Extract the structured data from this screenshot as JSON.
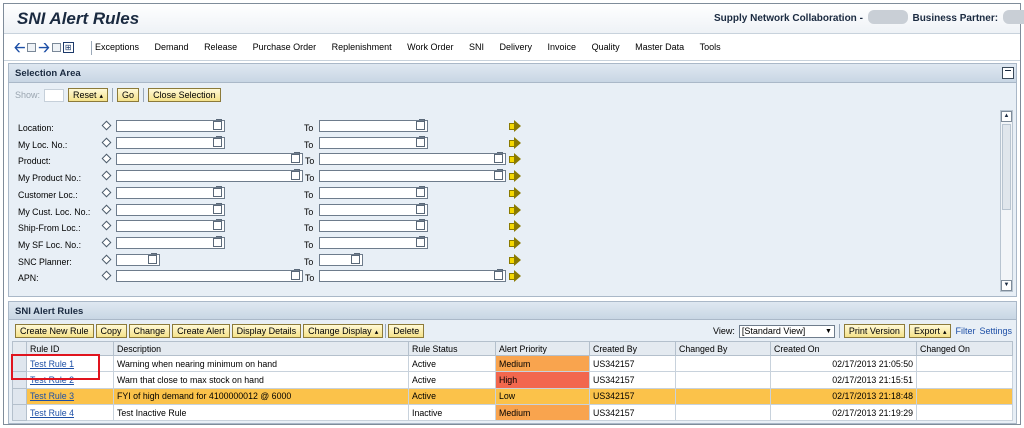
{
  "header": {
    "title": "SNI Alert Rules",
    "collab_label": "Supply Network Collaboration -",
    "partner_label": "Business Partner:"
  },
  "nav": {
    "items": [
      "Exceptions",
      "Demand",
      "Release",
      "Purchase Order",
      "Replenishment",
      "Work Order",
      "SNI",
      "Delivery",
      "Invoice",
      "Quality",
      "Master Data",
      "Tools"
    ]
  },
  "selection": {
    "title": "Selection Area",
    "show_label": "Show:",
    "reset_button": "Reset",
    "go_button": "Go",
    "close_button": "Close Selection",
    "to_label": "To",
    "criteria": [
      {
        "label": "Location:",
        "width": "short"
      },
      {
        "label": "My Loc. No.:",
        "width": "short"
      },
      {
        "label": "Product:",
        "width": "long"
      },
      {
        "label": "My Product No.:",
        "width": "long"
      },
      {
        "label": "Customer Loc.:",
        "width": "short"
      },
      {
        "label": "My Cust. Loc. No.:",
        "width": "short"
      },
      {
        "label": "Ship-From Loc.:",
        "width": "short"
      },
      {
        "label": "My SF Loc. No.:",
        "width": "short"
      },
      {
        "label": "SNC Planner:",
        "width": "tiny"
      },
      {
        "label": "APN:",
        "width": "long"
      }
    ]
  },
  "rules": {
    "title": "SNI Alert Rules",
    "buttons": [
      "Create New Rule",
      "Copy",
      "Change",
      "Create Alert",
      "Display Details",
      "Change Display",
      "Delete"
    ],
    "view_label": "View:",
    "view_value": "[Standard View]",
    "print_button": "Print Version",
    "export_button": "Export",
    "filter_link": "Filter",
    "settings_link": "Settings",
    "columns": [
      "Rule ID",
      "Description",
      "Rule Status",
      "Alert Priority",
      "Created By",
      "Changed By",
      "Created On",
      "Changed On"
    ],
    "rows": [
      {
        "id": "Test Rule 1",
        "description": "Warning when nearing minimum on hand",
        "status": "Active",
        "priority": "Medium",
        "created_by": "US342157",
        "changed_by": "",
        "created_on": "02/17/2013 21:05:50",
        "changed_on": "",
        "highlight": false
      },
      {
        "id": "Test Rule 2",
        "description": "Warn that close to max stock on hand",
        "status": "Active",
        "priority": "High",
        "created_by": "US342157",
        "changed_by": "",
        "created_on": "02/17/2013 21:15:51",
        "changed_on": "",
        "highlight": false
      },
      {
        "id": "Test Rule 3",
        "description": "FYI of high demand for 4100000012 @ 6000",
        "status": "Active",
        "priority": "Low",
        "created_by": "US342157",
        "changed_by": "",
        "created_on": "02/17/2013 21:18:48",
        "changed_on": "",
        "highlight": true
      },
      {
        "id": "Test Rule 4",
        "description": "Test Inactive Rule",
        "status": "Inactive",
        "priority": "Medium",
        "created_by": "US342157",
        "changed_by": "",
        "created_on": "02/17/2013 21:19:29",
        "changed_on": "",
        "highlight": false
      }
    ]
  }
}
